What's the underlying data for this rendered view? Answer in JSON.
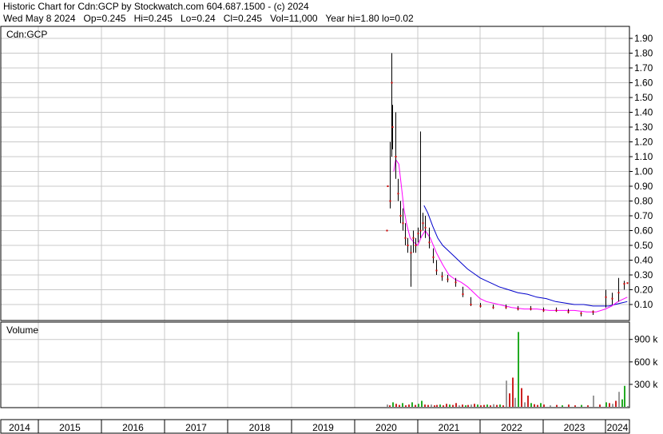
{
  "header": {
    "line1": "Historic Chart for Cdn:GCP by Stockwatch.com 604.687.1500 - (c) 2024",
    "date": "Wed May  8 2024",
    "op": "Op=0.245",
    "hi": "Hi=0.245",
    "lo": "Lo=0.24",
    "cl": "Cl=0.245",
    "vol": "Vol=11,000",
    "year_range": "Year hi=1.80  lo=0.02"
  },
  "colors": {
    "candle": "#000000",
    "close_dot": "#cc0000",
    "ma_short": "#ff00ff",
    "ma_long": "#0000cc",
    "vol_up": "#22aa22",
    "vol_down": "#cc2222",
    "vol_flat": "#999999",
    "grid": "#c8c8c8"
  },
  "chart_data": [
    {
      "type": "line",
      "panel": "price",
      "title": "Cdn:GCP",
      "ylim": [
        0.0,
        1.95
      ],
      "yticks": [
        "1.90",
        "1.80",
        "1.70",
        "1.60",
        "1.50",
        "1.40",
        "1.30",
        "1.20",
        "1.10",
        "1.00",
        "0.90",
        "0.80",
        "0.70",
        "0.60",
        "0.50",
        "0.40",
        "0.30",
        "0.20",
        "0.10"
      ],
      "xlim": [
        2014.0,
        2024.4
      ],
      "xtick_labels": [
        "2014",
        "2015",
        "2016",
        "2017",
        "2018",
        "2019",
        "2020",
        "2021",
        "2022",
        "2023",
        "2024"
      ],
      "grid": true,
      "series": [
        {
          "style": "hlc_bars",
          "points": [
            [
              2020.5,
              0.6,
              0.6,
              0.6
            ],
            [
              2020.52,
              0.9,
              0.9,
              0.9
            ],
            [
              2020.56,
              1.2,
              0.75,
              0.8
            ],
            [
              2020.58,
              1.8,
              1.1,
              1.6
            ],
            [
              2020.6,
              1.45,
              1.15,
              1.3
            ],
            [
              2020.64,
              1.4,
              0.95,
              1.1
            ],
            [
              2020.68,
              0.95,
              0.8,
              0.85
            ],
            [
              2020.72,
              0.8,
              0.65,
              0.7
            ],
            [
              2020.76,
              0.75,
              0.6,
              0.65
            ],
            [
              2020.8,
              0.65,
              0.5,
              0.55
            ],
            [
              2020.84,
              0.55,
              0.45,
              0.5
            ],
            [
              2020.88,
              0.5,
              0.22,
              0.45
            ],
            [
              2020.92,
              0.6,
              0.45,
              0.55
            ],
            [
              2020.96,
              0.55,
              0.45,
              0.5
            ],
            [
              2021.0,
              0.62,
              0.52,
              0.58
            ],
            [
              2021.04,
              1.27,
              0.55,
              0.6
            ],
            [
              2021.08,
              0.72,
              0.6,
              0.65
            ],
            [
              2021.12,
              0.7,
              0.55,
              0.62
            ],
            [
              2021.18,
              0.62,
              0.48,
              0.52
            ],
            [
              2021.24,
              0.48,
              0.38,
              0.42
            ],
            [
              2021.3,
              0.4,
              0.3,
              0.33
            ],
            [
              2021.38,
              0.32,
              0.26,
              0.29
            ],
            [
              2021.48,
              0.3,
              0.25,
              0.27
            ],
            [
              2021.6,
              0.28,
              0.22,
              0.25
            ],
            [
              2021.72,
              0.22,
              0.15,
              0.17
            ],
            [
              2021.85,
              0.15,
              0.09,
              0.1
            ],
            [
              2022.0,
              0.11,
              0.08,
              0.09
            ],
            [
              2022.2,
              0.1,
              0.07,
              0.08
            ],
            [
              2022.4,
              0.1,
              0.07,
              0.08
            ],
            [
              2022.6,
              0.09,
              0.06,
              0.07
            ],
            [
              2022.8,
              0.09,
              0.06,
              0.07
            ],
            [
              2023.0,
              0.08,
              0.05,
              0.06
            ],
            [
              2023.2,
              0.08,
              0.05,
              0.06
            ],
            [
              2023.4,
              0.07,
              0.04,
              0.05
            ],
            [
              2023.6,
              0.05,
              0.02,
              0.04
            ],
            [
              2023.8,
              0.06,
              0.03,
              0.05
            ],
            [
              2024.0,
              0.2,
              0.08,
              0.15
            ],
            [
              2024.1,
              0.18,
              0.1,
              0.14
            ],
            [
              2024.2,
              0.28,
              0.12,
              0.18
            ],
            [
              2024.3,
              0.26,
              0.2,
              0.24
            ],
            [
              2024.35,
              0.245,
              0.24,
              0.245
            ]
          ]
        },
        {
          "style": "line",
          "color_key": "ma_short",
          "points": [
            [
              2020.62,
              1.0
            ],
            [
              2020.65,
              1.08
            ],
            [
              2020.7,
              1.05
            ],
            [
              2020.74,
              0.9
            ],
            [
              2020.78,
              0.75
            ],
            [
              2020.82,
              0.65
            ],
            [
              2020.88,
              0.55
            ],
            [
              2020.94,
              0.52
            ],
            [
              2021.0,
              0.5
            ],
            [
              2021.06,
              0.56
            ],
            [
              2021.12,
              0.6
            ],
            [
              2021.2,
              0.55
            ],
            [
              2021.3,
              0.45
            ],
            [
              2021.4,
              0.37
            ],
            [
              2021.5,
              0.3
            ],
            [
              2021.6,
              0.27
            ],
            [
              2021.7,
              0.25
            ],
            [
              2021.8,
              0.22
            ],
            [
              2021.9,
              0.18
            ],
            [
              2022.0,
              0.14
            ],
            [
              2022.1,
              0.12
            ],
            [
              2022.3,
              0.1
            ],
            [
              2022.5,
              0.08
            ],
            [
              2022.7,
              0.07
            ],
            [
              2022.9,
              0.07
            ],
            [
              2023.1,
              0.06
            ],
            [
              2023.3,
              0.06
            ],
            [
              2023.5,
              0.06
            ],
            [
              2023.7,
              0.05
            ],
            [
              2023.85,
              0.05
            ],
            [
              2024.0,
              0.07
            ],
            [
              2024.1,
              0.09
            ],
            [
              2024.2,
              0.12
            ],
            [
              2024.35,
              0.15
            ]
          ]
        },
        {
          "style": "line",
          "color_key": "ma_long",
          "points": [
            [
              2021.1,
              0.77
            ],
            [
              2021.16,
              0.72
            ],
            [
              2021.24,
              0.63
            ],
            [
              2021.32,
              0.55
            ],
            [
              2021.4,
              0.5
            ],
            [
              2021.5,
              0.46
            ],
            [
              2021.6,
              0.42
            ],
            [
              2021.7,
              0.38
            ],
            [
              2021.8,
              0.34
            ],
            [
              2021.9,
              0.31
            ],
            [
              2022.0,
              0.28
            ],
            [
              2022.1,
              0.26
            ],
            [
              2022.2,
              0.24
            ],
            [
              2022.3,
              0.22
            ],
            [
              2022.45,
              0.2
            ],
            [
              2022.6,
              0.18
            ],
            [
              2022.75,
              0.17
            ],
            [
              2022.9,
              0.15
            ],
            [
              2023.05,
              0.14
            ],
            [
              2023.2,
              0.12
            ],
            [
              2023.35,
              0.11
            ],
            [
              2023.5,
              0.1
            ],
            [
              2023.65,
              0.1
            ],
            [
              2023.8,
              0.09
            ],
            [
              2023.95,
              0.09
            ],
            [
              2024.05,
              0.09
            ],
            [
              2024.15,
              0.1
            ],
            [
              2024.25,
              0.11
            ],
            [
              2024.35,
              0.12
            ]
          ]
        }
      ]
    },
    {
      "type": "bar",
      "panel": "volume",
      "title": "Volume",
      "ylim": [
        0,
        1100000
      ],
      "ytick_labels": [
        "900 k",
        "600 k",
        "300 k"
      ],
      "ytick_values": [
        900000,
        600000,
        300000
      ],
      "bars": [
        [
          2020.5,
          30000,
          "flat"
        ],
        [
          2020.55,
          20000,
          "down"
        ],
        [
          2020.6,
          60000,
          "up"
        ],
        [
          2020.65,
          40000,
          "down"
        ],
        [
          2020.7,
          25000,
          "down"
        ],
        [
          2020.75,
          50000,
          "up"
        ],
        [
          2020.8,
          20000,
          "down"
        ],
        [
          2020.85,
          30000,
          "down"
        ],
        [
          2020.9,
          60000,
          "up"
        ],
        [
          2020.95,
          25000,
          "down"
        ],
        [
          2021.0,
          40000,
          "up"
        ],
        [
          2021.05,
          80000,
          "up"
        ],
        [
          2021.1,
          30000,
          "down"
        ],
        [
          2021.15,
          25000,
          "down"
        ],
        [
          2021.2,
          30000,
          "flat"
        ],
        [
          2021.25,
          20000,
          "down"
        ],
        [
          2021.3,
          25000,
          "down"
        ],
        [
          2021.35,
          30000,
          "up"
        ],
        [
          2021.4,
          20000,
          "down"
        ],
        [
          2021.45,
          40000,
          "down"
        ],
        [
          2021.5,
          30000,
          "up"
        ],
        [
          2021.55,
          25000,
          "down"
        ],
        [
          2021.6,
          50000,
          "down"
        ],
        [
          2021.65,
          20000,
          "flat"
        ],
        [
          2021.7,
          30000,
          "down"
        ],
        [
          2021.75,
          20000,
          "up"
        ],
        [
          2021.8,
          25000,
          "down"
        ],
        [
          2021.85,
          30000,
          "flat"
        ],
        [
          2021.9,
          40000,
          "down"
        ],
        [
          2021.95,
          30000,
          "up"
        ],
        [
          2022.0,
          20000,
          "down"
        ],
        [
          2022.05,
          25000,
          "down"
        ],
        [
          2022.1,
          30000,
          "up"
        ],
        [
          2022.15,
          20000,
          "down"
        ],
        [
          2022.2,
          35000,
          "flat"
        ],
        [
          2022.25,
          25000,
          "down"
        ],
        [
          2022.3,
          30000,
          "up"
        ],
        [
          2022.35,
          20000,
          "down"
        ],
        [
          2022.4,
          350000,
          "flat"
        ],
        [
          2022.45,
          180000,
          "down"
        ],
        [
          2022.5,
          390000,
          "down"
        ],
        [
          2022.55,
          120000,
          "flat"
        ],
        [
          2022.6,
          1000000,
          "up"
        ],
        [
          2022.65,
          250000,
          "down"
        ],
        [
          2022.7,
          60000,
          "flat"
        ],
        [
          2022.75,
          150000,
          "down"
        ],
        [
          2022.8,
          50000,
          "up"
        ],
        [
          2022.85,
          35000,
          "down"
        ],
        [
          2022.9,
          25000,
          "down"
        ],
        [
          2022.95,
          50000,
          "up"
        ],
        [
          2023.0,
          30000,
          "down"
        ],
        [
          2023.1,
          20000,
          "flat"
        ],
        [
          2023.2,
          25000,
          "down"
        ],
        [
          2023.3,
          20000,
          "up"
        ],
        [
          2023.4,
          30000,
          "down"
        ],
        [
          2023.5,
          20000,
          "down"
        ],
        [
          2023.6,
          25000,
          "up"
        ],
        [
          2023.7,
          20000,
          "down"
        ],
        [
          2023.8,
          150000,
          "flat"
        ],
        [
          2023.9,
          30000,
          "down"
        ],
        [
          2024.0,
          60000,
          "up"
        ],
        [
          2024.05,
          50000,
          "down"
        ],
        [
          2024.1,
          40000,
          "flat"
        ],
        [
          2024.15,
          80000,
          "down"
        ],
        [
          2024.2,
          200000,
          "flat"
        ],
        [
          2024.25,
          100000,
          "up"
        ],
        [
          2024.3,
          280000,
          "up"
        ],
        [
          2024.35,
          11000,
          "flat"
        ]
      ]
    }
  ]
}
